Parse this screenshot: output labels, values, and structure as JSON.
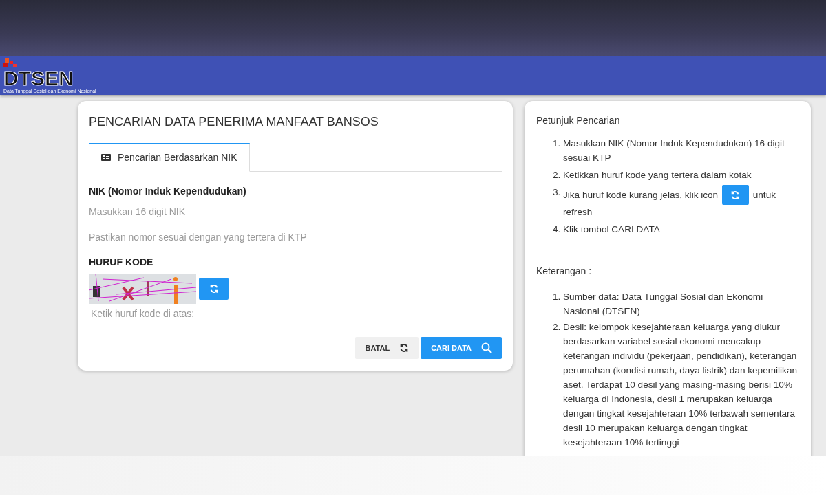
{
  "header": {
    "logo_text": "DTSEN",
    "logo_subtitle": "Data Tunggal Sosial dan Ekonomi Nasional"
  },
  "search_card": {
    "title": "PENCARIAN DATA PENERIMA MANFAAT BANSOS",
    "tabs": [
      {
        "label": "Pencarian Berdasarkan NIK",
        "selected": true
      }
    ],
    "nik_label": "NIK (Nomor Induk Kependudukan)",
    "nik_placeholder": "Masukkan 16 digit NIK",
    "nik_hint": "Pastikan nomor sesuai dengan yang tertera di KTP",
    "code_label": "HURUF KODE",
    "code_placeholder": "Ketik huruf kode di atas:",
    "buttons": [
      {
        "label": "BATAL",
        "kind": "reset"
      },
      {
        "label": "CARI DATA",
        "kind": "search"
      }
    ]
  },
  "help_card": {
    "title": "Petunjuk Pencarian",
    "steps": [
      {
        "kind": "text",
        "marker": "1.",
        "text": "Masukkan NIK (Nomor Induk Kependudukan) 16 digit sesuai KTP"
      },
      {
        "kind": "text",
        "marker": "2.",
        "text": "Ketikkan huruf kode yang tertera dalam kotak"
      },
      {
        "kind": "icon",
        "marker": "3.",
        "text": "Jika huruf kode kurang jelas, klik icon",
        "after": "untuk",
        "continuation": "refresh"
      },
      {
        "kind": "text",
        "marker": "4.",
        "text": "Klik tombol CARI DATA"
      }
    ],
    "notes_title": "Keterangan :",
    "notes": [
      {
        "marker": "1.",
        "text": "Sumber data: Data Tunggal Sosial dan Ekonomi Nasional (DTSEN)"
      },
      {
        "marker": "2.",
        "text": "Desil: kelompok kesejahteraan keluarga yang diukur berdasarkan variabel sosial ekonomi mencakup keterangan individu (pekerjaan, pendidikan), keterangan perumahan (kondisi rumah, daya listrik) dan kepemilikan aset. Terdapat 10 desil yang masing-masing berisi 10% keluarga di Indonesia, desil 1 merupakan keluarga dengan tingkat kesejahteraan 10% terbawah sementara desil 10 merupakan keluarga dengan tingkat kesejahteraan 10% tertinggi"
      }
    ]
  }
}
